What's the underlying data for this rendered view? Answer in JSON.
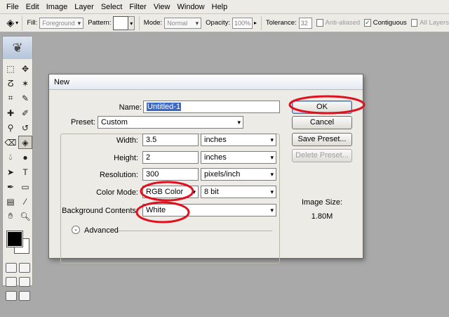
{
  "menu": [
    "File",
    "Edit",
    "Image",
    "Layer",
    "Select",
    "Filter",
    "View",
    "Window",
    "Help"
  ],
  "options_bar": {
    "fill_label": "Fill:",
    "fill_value": "Foreground",
    "pattern_label": "Pattern:",
    "mode_label": "Mode:",
    "mode_value": "Normal",
    "opacity_label": "Opacity:",
    "opacity_value": "100%",
    "tolerance_label": "Tolerance:",
    "tolerance_value": "32",
    "anti_aliased_label": "Anti-aliased",
    "contiguous_label": "Contiguous",
    "all_layers_label": "All Layers"
  },
  "dialog": {
    "title": "New",
    "name_label": "Name:",
    "name_value": "Untitled-1",
    "preset_label": "Preset:",
    "preset_value": "Custom",
    "width_label": "Width:",
    "width_value": "3.5",
    "width_unit": "inches",
    "height_label": "Height:",
    "height_value": "2",
    "height_unit": "inches",
    "resolution_label": "Resolution:",
    "resolution_value": "300",
    "resolution_unit": "pixels/inch",
    "color_mode_label": "Color Mode:",
    "color_mode_value": "RGB Color",
    "bit_depth_value": "8 bit",
    "background_label": "Background Contents:",
    "background_value": "White",
    "advanced_label": "Advanced",
    "buttons": {
      "ok": "OK",
      "cancel": "Cancel",
      "save_preset": "Save Preset...",
      "delete_preset": "Delete Preset..."
    },
    "image_size_label": "Image Size:",
    "image_size_value": "1.80M"
  },
  "annotation_color": "#e0101e"
}
